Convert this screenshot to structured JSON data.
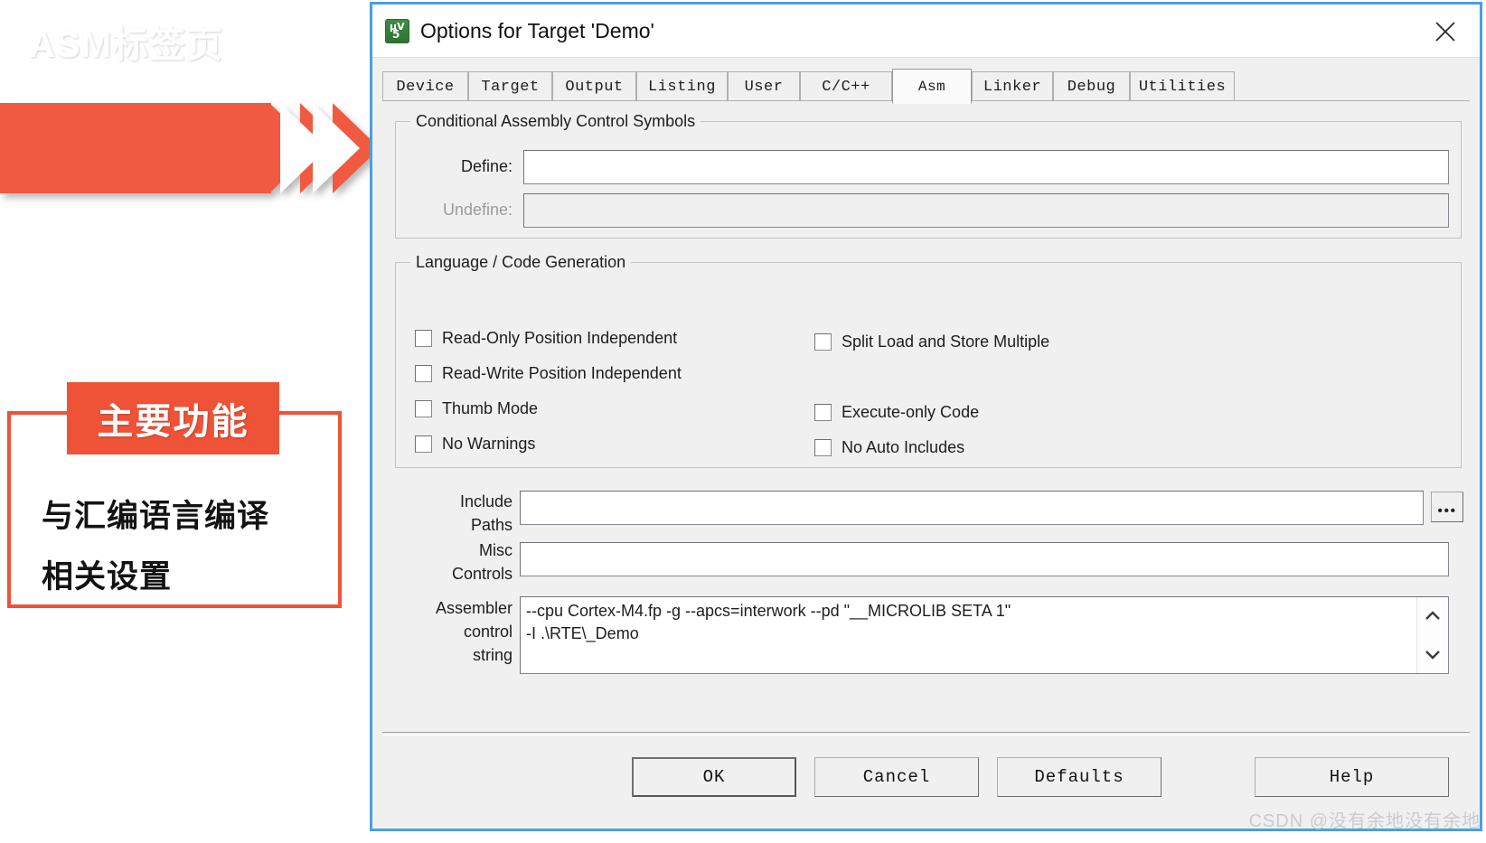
{
  "annotations": {
    "banner_label": "ASM标签页",
    "callout_title": "主要功能",
    "callout_line1": "与汇编语言编译",
    "callout_line2": "相关设置",
    "accent_color": "#ee5337"
  },
  "dialog": {
    "title": "Options for Target 'Demo'",
    "close_label": "✕",
    "icon_top": "µV",
    "icon_bottom": "5",
    "tabs": [
      {
        "label": "Device",
        "active": false
      },
      {
        "label": "Target",
        "active": false
      },
      {
        "label": "Output",
        "active": false
      },
      {
        "label": "Listing",
        "active": false
      },
      {
        "label": "User",
        "active": false
      },
      {
        "label": "C/C++",
        "active": false
      },
      {
        "label": "Asm",
        "active": true
      },
      {
        "label": "Linker",
        "active": false
      },
      {
        "label": "Debug",
        "active": false
      },
      {
        "label": "Utilities",
        "active": false
      }
    ],
    "conditional_group": {
      "title": "Conditional Assembly Control Symbols",
      "define_label": "Define:",
      "define_value": "",
      "undefine_label": "Undefine:",
      "undefine_value": "",
      "undefine_disabled": true
    },
    "language_group": {
      "title": "Language / Code Generation",
      "checkboxes_left": [
        {
          "label": "Read-Only Position Independent",
          "checked": false
        },
        {
          "label": "Read-Write Position Independent",
          "checked": false
        },
        {
          "label": "Thumb Mode",
          "checked": false
        },
        {
          "label": "No Warnings",
          "checked": false
        }
      ],
      "checkboxes_right": [
        {
          "label": "Split Load and Store Multiple",
          "checked": false
        },
        {
          "label": "Execute-only Code",
          "checked": false
        },
        {
          "label": "No Auto Includes",
          "checked": false
        }
      ]
    },
    "include_paths": {
      "label_line1": "Include",
      "label_line2": "Paths",
      "value": "",
      "browse_label": "•••"
    },
    "misc_controls": {
      "label_line1": "Misc",
      "label_line2": "Controls",
      "value": ""
    },
    "assembler_control": {
      "label_line1": "Assembler",
      "label_line2": "control",
      "label_line3": "string",
      "value": "--cpu Cortex-M4.fp -g --apcs=interwork --pd \"__MICROLIB SETA 1\"\n-I .\\RTE\\_Demo",
      "scroll_up_icon": "chevron-up",
      "scroll_down_icon": "chevron-down"
    },
    "buttons": [
      {
        "label": "OK",
        "default": true
      },
      {
        "label": "Cancel",
        "default": false
      },
      {
        "label": "Defaults",
        "default": false
      },
      {
        "label": "Help",
        "default": false
      }
    ]
  },
  "watermark": "CSDN @没有余地没有余地"
}
